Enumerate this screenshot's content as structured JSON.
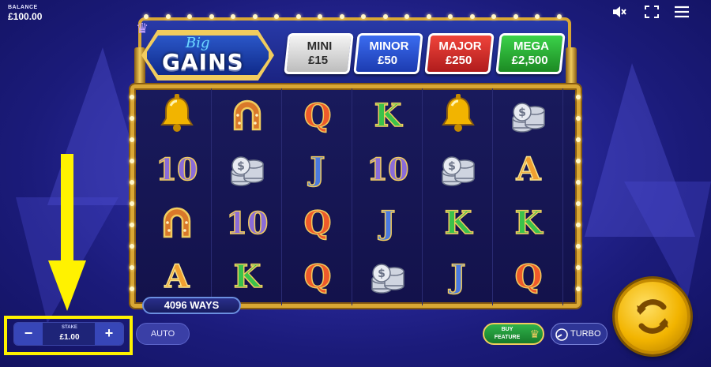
{
  "balance": {
    "label": "BALANCE",
    "value": "£100.00"
  },
  "topbar": {
    "icons": [
      "mute-icon",
      "fullscreen-icon",
      "menu-icon"
    ]
  },
  "logo": {
    "line1": "Big",
    "line2": "GAINS"
  },
  "jackpots": [
    {
      "name": "MINI",
      "value": "£15",
      "color": "#d8d8d8"
    },
    {
      "name": "MINOR",
      "value": "£50",
      "color": "#2e57d6"
    },
    {
      "name": "MAJOR",
      "value": "£250",
      "color": "#d6302e"
    },
    {
      "name": "MEGA",
      "value": "£2,500",
      "color": "#2eb23c"
    }
  ],
  "reels": [
    [
      "bell",
      "10",
      "horseshoe",
      "A"
    ],
    [
      "horseshoe",
      "coins",
      "10",
      "K"
    ],
    [
      "Q",
      "J",
      "Q",
      "Q"
    ],
    [
      "K",
      "10",
      "J",
      "coins"
    ],
    [
      "bell",
      "coins",
      "K",
      "J"
    ],
    [
      "coins",
      "A",
      "K",
      "Q"
    ]
  ],
  "ways": "4096 WAYS",
  "stake": {
    "label": "STAKE",
    "value": "£1.00",
    "minus": "−",
    "plus": "+"
  },
  "buttons": {
    "auto": "AUTO",
    "buy_feature": "BUY FEATURE",
    "turbo": "TURBO"
  },
  "colors": {
    "frame_gold": "#d9a734",
    "highlight": "#fff200",
    "spin": "#f2b400"
  }
}
